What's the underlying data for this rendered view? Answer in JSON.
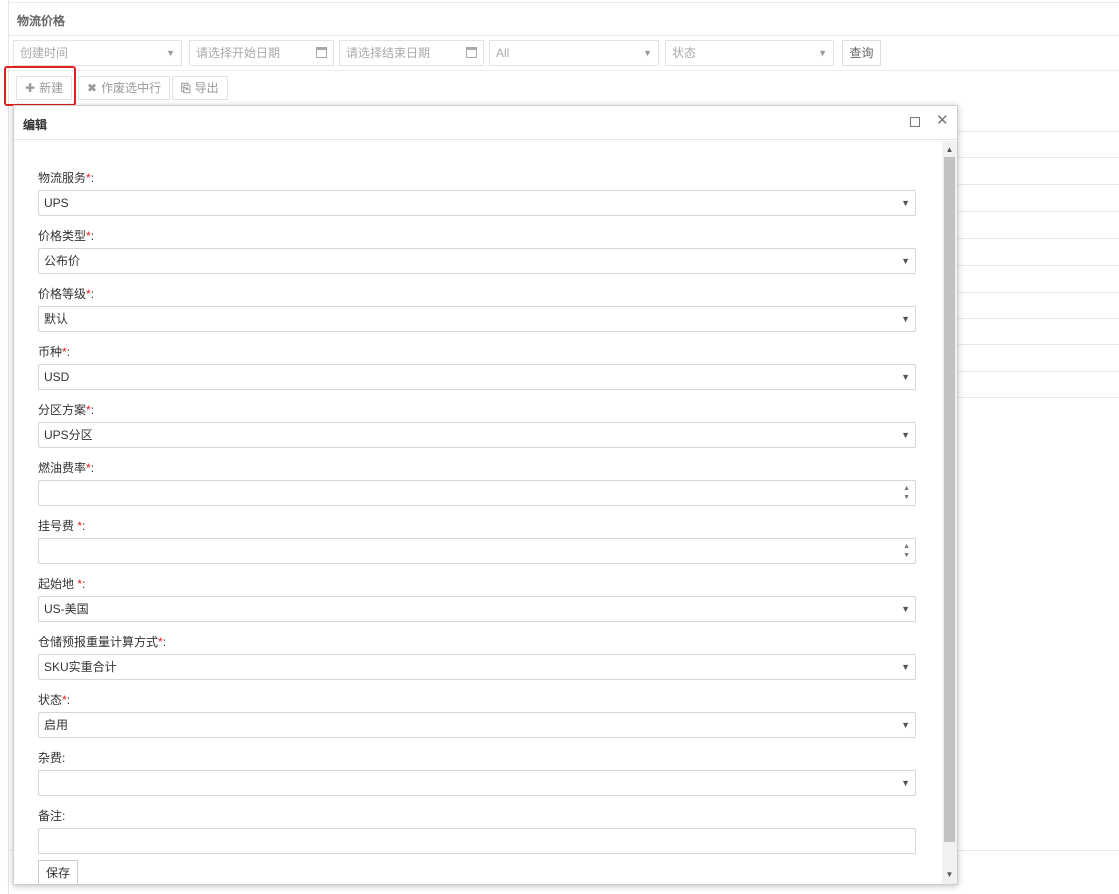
{
  "page": {
    "title": "物流价格"
  },
  "filters": {
    "created_time": "创建时间",
    "start_date_placeholder": "请选择开始日期",
    "end_date_placeholder": "请选择结束日期",
    "all_option": "All",
    "status": "状态",
    "query_label": "查询"
  },
  "toolbar": {
    "new_icon": "plus-icon",
    "new_label": "新建",
    "void_icon": "times-icon",
    "void_label": "作废选中行",
    "export_icon": "file-export-icon",
    "export_label": "导出"
  },
  "dialog": {
    "title": "编辑",
    "fields": [
      {
        "label": "物流服务",
        "required_mark": "*",
        "suffix": ":",
        "value": "UPS",
        "type": "select"
      },
      {
        "label": "价格类型",
        "required_mark": "*",
        "suffix": ":",
        "value": "公布价",
        "type": "select"
      },
      {
        "label": "价格等级",
        "required_mark": "*",
        "suffix": ":",
        "value": "默认",
        "type": "select"
      },
      {
        "label": "币种",
        "required_mark": "*",
        "suffix": ":",
        "value": "USD",
        "type": "select"
      },
      {
        "label": "分区方案",
        "required_mark": "*",
        "suffix": ":",
        "value": "UPS分区",
        "type": "select"
      },
      {
        "label": "燃油费率",
        "required_mark": "*",
        "suffix": ":",
        "value": "",
        "type": "number"
      },
      {
        "label": "挂号费 ",
        "required_mark": "*",
        "suffix": ":",
        "value": "",
        "type": "number"
      },
      {
        "label": "起始地 ",
        "required_mark": "*",
        "suffix": ":",
        "value": "US-美国",
        "type": "select"
      },
      {
        "label": "仓储预报重量计算方式",
        "required_mark": "*",
        "suffix": ":",
        "value": "SKU实重合计",
        "type": "select"
      },
      {
        "label": "状态",
        "required_mark": "*",
        "suffix": ":",
        "value": "启用",
        "type": "select"
      },
      {
        "label": "杂费",
        "required_mark": "",
        "suffix": ":",
        "value": "",
        "type": "select"
      },
      {
        "label": "备注",
        "required_mark": "",
        "suffix": ":",
        "value": "",
        "type": "text"
      }
    ],
    "save_label": "保存"
  },
  "colors": {
    "highlight": "#e02020",
    "required": "#e02020"
  }
}
